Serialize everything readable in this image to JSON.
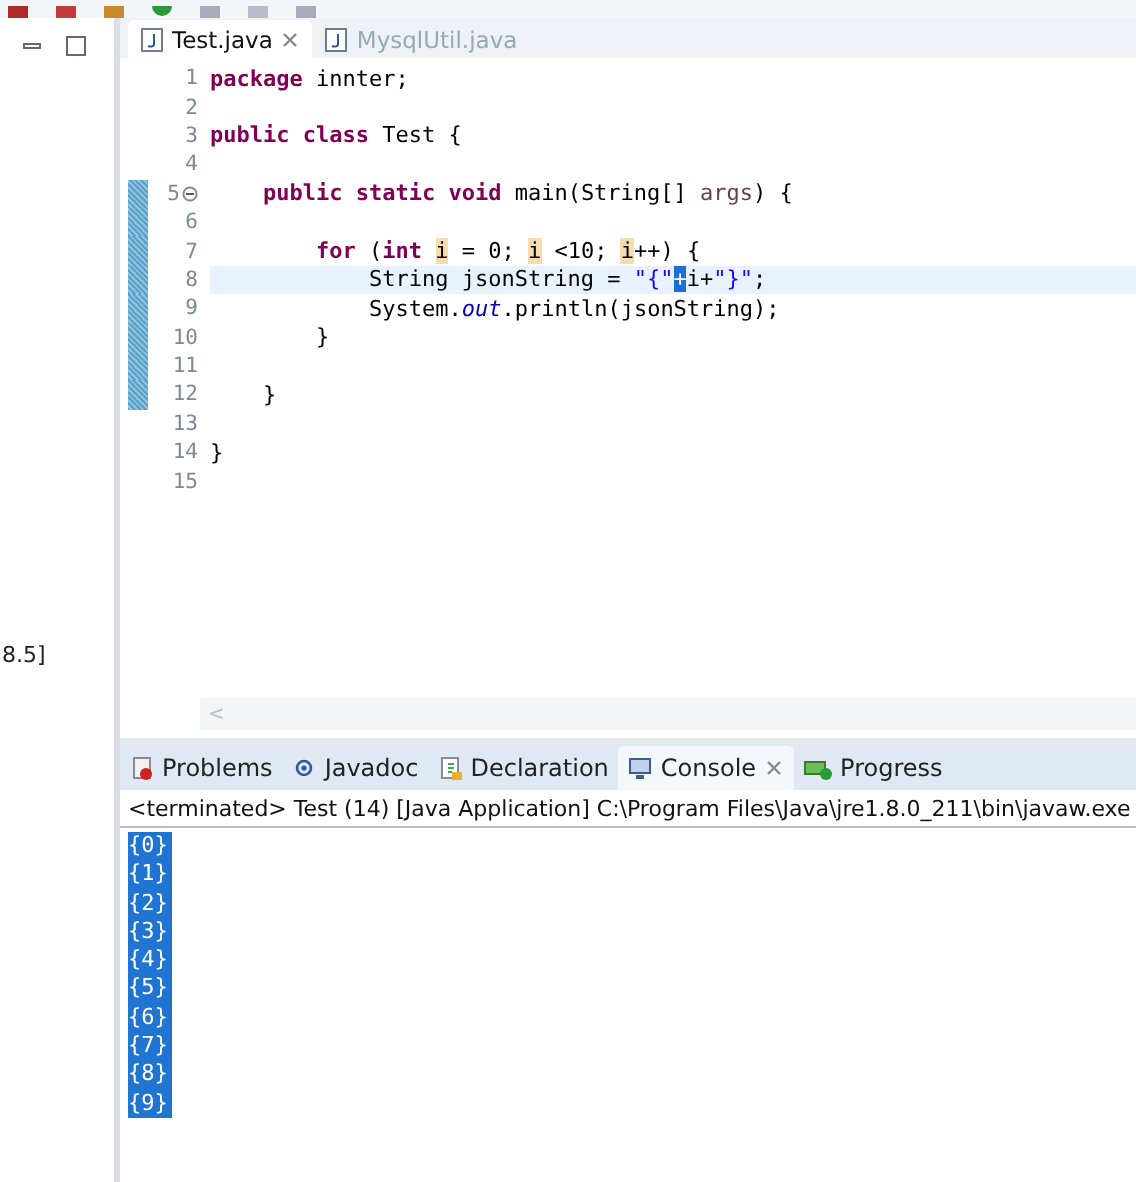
{
  "left_panel": {
    "label": "8.5]"
  },
  "editor": {
    "tabs": [
      {
        "label": "Test.java",
        "selected": true,
        "closable": true
      },
      {
        "label": "MysqlUtil.java",
        "selected": false,
        "closable": false
      }
    ],
    "lines": [
      {
        "number": "1",
        "tokens": [
          {
            "kind": "keyword",
            "text": "package"
          },
          {
            "kind": "plain",
            "text": " innter;"
          }
        ]
      },
      {
        "number": "2"
      },
      {
        "number": "3",
        "tokens": [
          {
            "kind": "keyword",
            "text": "public class"
          },
          {
            "kind": "plain",
            "text": " Test {"
          }
        ]
      },
      {
        "number": "4"
      },
      {
        "number": "5",
        "changed": true,
        "foldable": true,
        "tokens": [
          {
            "kind": "keyword",
            "text": "    public static void"
          },
          {
            "kind": "plain",
            "text": " main(String[] "
          },
          {
            "kind": "param",
            "text": "args"
          },
          {
            "kind": "plain",
            "text": ") {"
          }
        ]
      },
      {
        "number": "6",
        "changed": true
      },
      {
        "number": "7",
        "changed": true,
        "tokens": [
          {
            "kind": "keyword",
            "text": "        for"
          },
          {
            "kind": "plain",
            "text": " ("
          },
          {
            "kind": "keyword",
            "text": "int "
          },
          {
            "kind": "occurrence",
            "text": "i"
          },
          {
            "kind": "plain",
            "text": " = 0; "
          },
          {
            "kind": "occurrence",
            "text": "i"
          },
          {
            "kind": "plain",
            "text": " <10; "
          },
          {
            "kind": "occurrence",
            "text": "i"
          },
          {
            "kind": "plain",
            "text": "++) {"
          }
        ]
      },
      {
        "number": "8",
        "changed": true,
        "current": true,
        "tokens": [
          {
            "kind": "plain",
            "text": "            String jsonString = "
          },
          {
            "kind": "string",
            "text": "\"{\""
          },
          {
            "kind": "caret",
            "text": "+"
          },
          {
            "kind": "plain",
            "text": "i+"
          },
          {
            "kind": "string",
            "text": "\"}\""
          },
          {
            "kind": "plain",
            "text": ";"
          }
        ]
      },
      {
        "number": "9",
        "changed": true,
        "tokens": [
          {
            "kind": "plain",
            "text": "            System."
          },
          {
            "kind": "field",
            "text": "out"
          },
          {
            "kind": "plain",
            "text": ".println(jsonString);"
          }
        ]
      },
      {
        "number": "10",
        "changed": true,
        "tokens": [
          {
            "kind": "plain",
            "text": "        }"
          }
        ]
      },
      {
        "number": "11",
        "changed": true
      },
      {
        "number": "12",
        "changed": true,
        "tokens": [
          {
            "kind": "plain",
            "text": "    }"
          }
        ]
      },
      {
        "number": "13"
      },
      {
        "number": "14",
        "tokens": [
          {
            "kind": "plain",
            "text": "}"
          }
        ]
      },
      {
        "number": "15"
      }
    ],
    "scroll_arrow": "<"
  },
  "views": {
    "tabs": [
      {
        "label": "Problems",
        "kind": "problems",
        "selected": false
      },
      {
        "label": "Javadoc",
        "kind": "javadoc",
        "selected": false
      },
      {
        "label": "Declaration",
        "kind": "declaration",
        "selected": false
      },
      {
        "label": "Console",
        "kind": "console",
        "selected": true
      },
      {
        "label": "Progress",
        "kind": "progress",
        "selected": false
      }
    ],
    "console_header": "<terminated> Test (14) [Java Application] C:\\Program Files\\Java\\jre1.8.0_211\\bin\\javaw.exe",
    "output": [
      {
        "text": "{0}",
        "selected": true
      },
      {
        "text": "{1}",
        "selected": true
      },
      {
        "text": "{2}",
        "selected": true
      },
      {
        "text": "{3}",
        "selected": true
      },
      {
        "text": "{4}",
        "selected": true
      },
      {
        "text": "{5}",
        "selected": true
      },
      {
        "text": "{6}",
        "selected": true
      },
      {
        "text": "{7}",
        "selected": true
      },
      {
        "text": "{8}",
        "selected": true
      },
      {
        "text": "{9}",
        "selected": true
      }
    ]
  }
}
